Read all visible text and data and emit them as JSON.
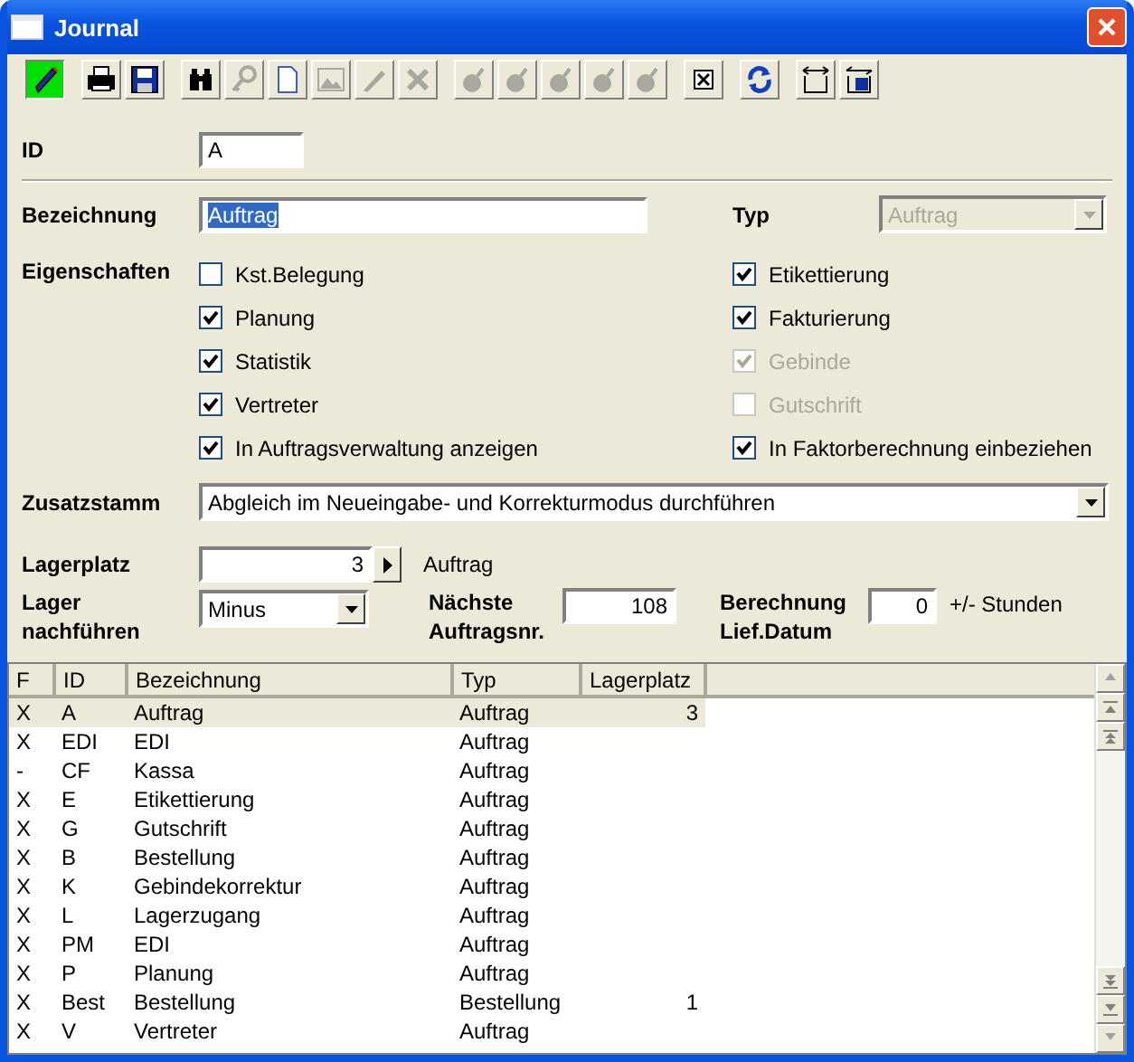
{
  "window": {
    "title": "Journal"
  },
  "toolbar": [
    [
      {
        "disabled": false,
        "selected": true
      }
    ],
    [
      {
        "disabled": false,
        "selected": false
      },
      {
        "disabled": false,
        "selected": false
      }
    ],
    [
      {
        "disabled": false,
        "selected": false
      },
      {
        "disabled": true,
        "selected": false
      },
      {
        "disabled": false,
        "selected": false
      },
      {
        "disabled": true,
        "selected": false
      },
      {
        "disabled": true,
        "selected": false
      },
      {
        "disabled": true,
        "selected": false
      }
    ],
    [
      {
        "disabled": true,
        "selected": false
      },
      {
        "disabled": true,
        "selected": false
      },
      {
        "disabled": true,
        "selected": false
      },
      {
        "disabled": true,
        "selected": false
      },
      {
        "disabled": true,
        "selected": false
      }
    ],
    [
      {
        "disabled": false,
        "selected": false
      }
    ],
    [
      {
        "disabled": false,
        "selected": false
      }
    ],
    [
      {
        "disabled": false,
        "selected": false
      },
      {
        "disabled": false,
        "selected": false
      }
    ]
  ],
  "form": {
    "id": {
      "label": "ID",
      "value": "A"
    },
    "bezeichnung": {
      "label": "Bezeichnung",
      "value": "Auftrag",
      "value_selected": true
    },
    "typ": {
      "label": "Typ",
      "value": "Auftrag",
      "disabled": true
    },
    "eigenschaften": {
      "label": "Eigenschaften",
      "left": [
        {
          "label": "Kst.Belegung",
          "checked": false,
          "disabled": false
        },
        {
          "label": "Planung",
          "checked": true,
          "disabled": false
        },
        {
          "label": "Statistik",
          "checked": true,
          "disabled": false
        },
        {
          "label": "Vertreter",
          "checked": true,
          "disabled": false
        },
        {
          "label": "In Auftragsverwaltung anzeigen",
          "checked": true,
          "disabled": false
        }
      ],
      "right": [
        {
          "label": "Etikettierung",
          "checked": true,
          "disabled": false
        },
        {
          "label": "Fakturierung",
          "checked": true,
          "disabled": false
        },
        {
          "label": "Gebinde",
          "checked": true,
          "disabled": true
        },
        {
          "label": "Gutschrift",
          "checked": false,
          "disabled": true
        },
        {
          "label": "In Faktorberechnung einbeziehen",
          "checked": true,
          "disabled": false
        }
      ]
    },
    "zusatzstamm": {
      "label": "Zusatzstamm",
      "value": "Abgleich im Neueingabe- und Korrekturmodus durchführen"
    },
    "lagerplatz": {
      "label": "Lagerplatz",
      "value": "3",
      "note": "Auftrag"
    },
    "lager_nachfuehren": {
      "label": "Lager nachführen",
      "value": "Minus"
    },
    "naechste_auftragsnr": {
      "label": "Nächste Auftragsnr.",
      "value": "108"
    },
    "berechnung": {
      "label": "Berechnung Lief.Datum",
      "value": "0",
      "unit": "+/- Stunden"
    }
  },
  "table": {
    "columns": [
      "F",
      "ID",
      "Bezeichnung",
      "Typ",
      "Lagerplatz"
    ],
    "rows": [
      {
        "cells": [
          "X",
          "A",
          "Auftrag",
          "Auftrag",
          "3"
        ],
        "selected": true
      },
      {
        "cells": [
          "X",
          "EDI",
          "EDI",
          "Auftrag",
          ""
        ],
        "selected": false
      },
      {
        "cells": [
          "-",
          "CF",
          "Kassa",
          "Auftrag",
          ""
        ],
        "selected": false
      },
      {
        "cells": [
          "X",
          "E",
          "Etikettierung",
          "Auftrag",
          ""
        ],
        "selected": false
      },
      {
        "cells": [
          "X",
          "G",
          "Gutschrift",
          "Auftrag",
          ""
        ],
        "selected": false
      },
      {
        "cells": [
          "X",
          "B",
          "Bestellung",
          "Auftrag",
          ""
        ],
        "selected": false
      },
      {
        "cells": [
          "X",
          "K",
          "Gebindekorrektur",
          "Auftrag",
          ""
        ],
        "selected": false
      },
      {
        "cells": [
          "X",
          "L",
          "Lagerzugang",
          "Auftrag",
          ""
        ],
        "selected": false
      },
      {
        "cells": [
          "X",
          "PM",
          "EDI",
          "Auftrag",
          ""
        ],
        "selected": false
      },
      {
        "cells": [
          "X",
          "P",
          "Planung",
          "Auftrag",
          ""
        ],
        "selected": false
      },
      {
        "cells": [
          "X",
          "Best",
          "Bestellung",
          "Bestellung",
          "1"
        ],
        "selected": false
      },
      {
        "cells": [
          "X",
          "V",
          "Vertreter",
          "Auftrag",
          ""
        ],
        "selected": false
      }
    ]
  }
}
